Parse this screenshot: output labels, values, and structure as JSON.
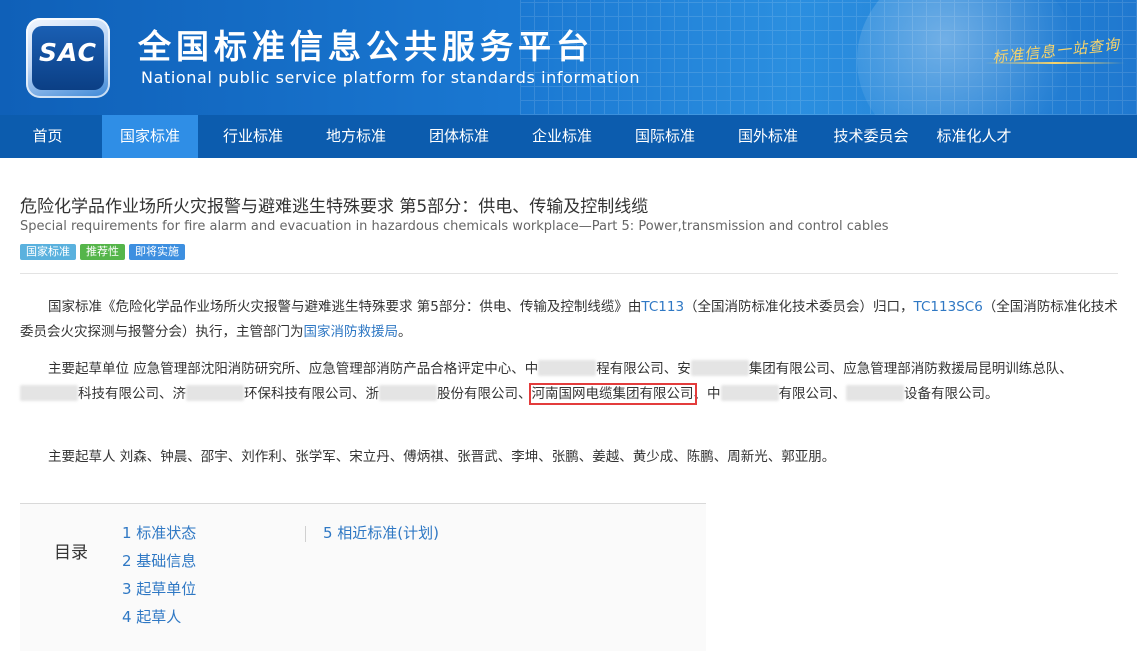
{
  "header": {
    "logo_text": "SAC",
    "title": "全国标准信息公共服务平台",
    "subtitle": "National public service platform  for standards information",
    "slogan": "标准信息一站查询"
  },
  "nav": {
    "items": [
      "首页",
      "国家标准",
      "行业标准",
      "地方标准",
      "团体标准",
      "企业标准",
      "国际标准",
      "国外标准",
      "技术委员会",
      "标准化人才"
    ],
    "active_index": 1
  },
  "standard": {
    "title_zh": "危险化学品作业场所火灾报警与避难逃生特殊要求 第5部分：供电、传输及控制线缆",
    "title_en": "Special requirements for fire alarm and evacuation in hazardous chemicals workplace—Part 5: Power,transmission and control cables",
    "badges": [
      "国家标准",
      "推荐性",
      "即将实施"
    ]
  },
  "intro": {
    "prefix": "国家标准《危险化学品作业场所火灾报警与避难逃生特殊要求 第5部分：供电、传输及控制线缆》由",
    "tc_link": "TC113",
    "tc_name": "（全国消防标准化技术委员会）归口，",
    "sc_link": "TC113SC6",
    "sc_name": "（全国消防标准化技术委员会火灾探测与报警分会）执行，主管部门为",
    "dept_link": "国家消防救援局",
    "suffix": "。"
  },
  "drafting_units": {
    "label": "主要起草单位",
    "text_1": "应急管理部沈阳消防研究所、应急管理部消防产品合格评定中心、中",
    "text_2": "程有限公司、安",
    "text_3": "集团有限公司、应急管理部消防救援局昆明训练总队、",
    "text_4": "科技有限公司、济",
    "text_5": "环保科技有限公司、浙",
    "text_6": "股份有限公司、",
    "highlighted_unit": "河南国网电缆集团有限公司",
    "text_7": "、中",
    "text_8": "有限公司、",
    "text_9": "设备有限公司。"
  },
  "drafters": {
    "label": "主要起草人",
    "names": "刘森、钟晨、邵宇、刘作利、张学军、宋立丹、傅炳祺、张晋武、李坤、张鹏、姜越、黄少成、陈鹏、周新光、郭亚朋。"
  },
  "toc": {
    "title": "目录",
    "items": [
      "1  标准状态",
      "2  基础信息",
      "3  起草单位",
      "4  起草人",
      "5  相近标准(计划)"
    ]
  }
}
